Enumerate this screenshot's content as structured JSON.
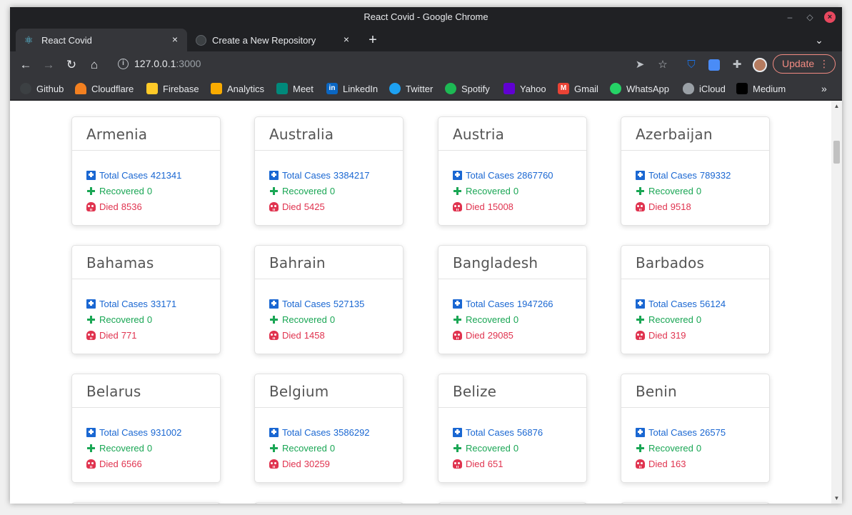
{
  "window": {
    "title": "React Covid - Google Chrome"
  },
  "tabs": [
    {
      "title": "React Covid",
      "active": true,
      "icon": "react-icon"
    },
    {
      "title": "Create a New Repository",
      "active": false,
      "icon": "github-icon"
    }
  ],
  "omnibox": {
    "host": "127.0.0.1",
    "port": ":3000"
  },
  "toolbar": {
    "update_label": "Update",
    "menu_glyph": "⋮"
  },
  "bookmarks": [
    {
      "label": "Github",
      "icon": "github-icon",
      "color": "#24292e"
    },
    {
      "label": "Cloudflare",
      "icon": "cloudflare-icon",
      "color": "#f38020"
    },
    {
      "label": "Firebase",
      "icon": "firebase-icon",
      "color": "#ffca28"
    },
    {
      "label": "Analytics",
      "icon": "analytics-icon",
      "color": "#f9ab00"
    },
    {
      "label": "Meet",
      "icon": "meet-icon",
      "color": "#00897b"
    },
    {
      "label": "LinkedIn",
      "icon": "linkedin-icon",
      "color": "#0a66c2"
    },
    {
      "label": "Twitter",
      "icon": "twitter-icon",
      "color": "#1da1f2"
    },
    {
      "label": "Spotify",
      "icon": "spotify-icon",
      "color": "#1db954"
    },
    {
      "label": "Yahoo",
      "icon": "yahoo-icon",
      "color": "#6001d2"
    },
    {
      "label": "Gmail",
      "icon": "gmail-icon",
      "color": "#ea4335"
    },
    {
      "label": "WhatsApp",
      "icon": "whatsapp-icon",
      "color": "#25d366"
    },
    {
      "label": "iCloud",
      "icon": "apple-icon",
      "color": "#9aa0a6"
    },
    {
      "label": "Medium",
      "icon": "medium-icon",
      "color": "#000000"
    }
  ],
  "labels": {
    "total_cases": "Total Cases",
    "recovered": "Recovered",
    "died": "Died"
  },
  "colors": {
    "cases": "#1a67d2",
    "recovered": "#19a654",
    "died": "#e0334f"
  },
  "countries": [
    {
      "name": "Armenia",
      "total_cases": "421341",
      "recovered": "0",
      "died": "8536"
    },
    {
      "name": "Australia",
      "total_cases": "3384217",
      "recovered": "0",
      "died": "5425"
    },
    {
      "name": "Austria",
      "total_cases": "2867760",
      "recovered": "0",
      "died": "15008"
    },
    {
      "name": "Azerbaijan",
      "total_cases": "789332",
      "recovered": "0",
      "died": "9518"
    },
    {
      "name": "Bahamas",
      "total_cases": "33171",
      "recovered": "0",
      "died": "771"
    },
    {
      "name": "Bahrain",
      "total_cases": "527135",
      "recovered": "0",
      "died": "1458"
    },
    {
      "name": "Bangladesh",
      "total_cases": "1947266",
      "recovered": "0",
      "died": "29085"
    },
    {
      "name": "Barbados",
      "total_cases": "56124",
      "recovered": "0",
      "died": "319"
    },
    {
      "name": "Belarus",
      "total_cases": "931002",
      "recovered": "0",
      "died": "6566"
    },
    {
      "name": "Belgium",
      "total_cases": "3586292",
      "recovered": "0",
      "died": "30259"
    },
    {
      "name": "Belize",
      "total_cases": "56876",
      "recovered": "0",
      "died": "651"
    },
    {
      "name": "Benin",
      "total_cases": "26575",
      "recovered": "0",
      "died": "163"
    }
  ]
}
